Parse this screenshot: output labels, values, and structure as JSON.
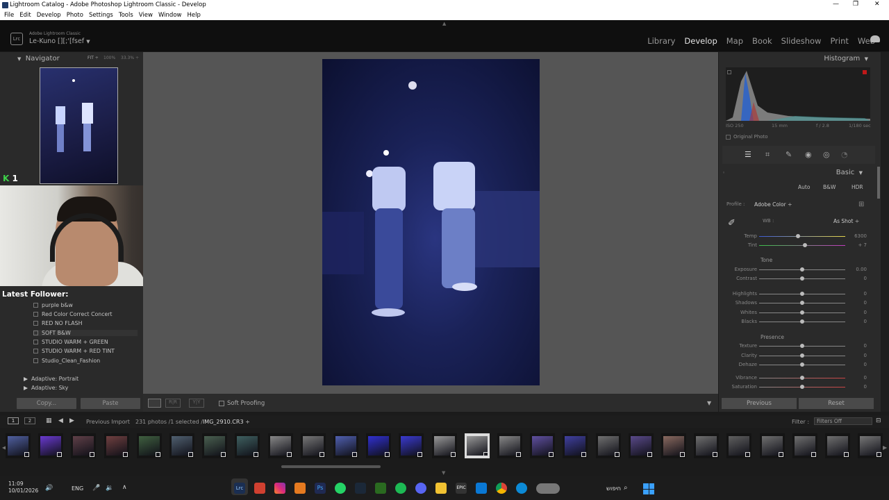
{
  "window": {
    "title": "Lightroom Catalog - Adobe Photoshop Lightroom Classic - Develop"
  },
  "menu": [
    "File",
    "Edit",
    "Develop",
    "Photo",
    "Settings",
    "Tools",
    "View",
    "Window",
    "Help"
  ],
  "identity": {
    "app_small": "Adobe Lightroom Classic",
    "catalog": "Le-Kuno [][;'[fsef",
    "logo": "Lrc"
  },
  "modules": [
    "Library",
    "Develop",
    "Map",
    "Book",
    "Slideshow",
    "Print",
    "Web"
  ],
  "active_module": "Develop",
  "navigator": {
    "title": "Navigator",
    "fit": "FIT ÷",
    "p100": "100%",
    "p33": "33.3% ÷"
  },
  "overlay": {
    "k_icon": "K",
    "k_count": "1",
    "latest_follower": "Latest Follower:"
  },
  "presets": [
    "purple b&w",
    "Red Color Correct Concert",
    "RED NO FLASH",
    "SOFT B&W",
    "STUDIO WARM + GREEN",
    "STUDIO WARM + RED TINT",
    "Studio_Clean_Fashion"
  ],
  "preset_groups": [
    "Adaptive: Portrait",
    "Adaptive: Sky"
  ],
  "left_buttons": {
    "copy": "Copy...",
    "paste": "Paste"
  },
  "toolbar": {
    "soft_proofing": "Soft Proofing"
  },
  "histogram": {
    "title": "Histogram",
    "iso": "ISO 250",
    "focal": "15 mm",
    "aperture": "f / 2.8",
    "shutter": "1/180 sec",
    "original_photo": "Original Photo"
  },
  "basic": {
    "title": "Basic",
    "modes": [
      "Auto",
      "B&W",
      "HDR"
    ],
    "profile_label": "Profile :",
    "profile_value": "Adobe Color ÷",
    "wb_label": "WB :",
    "wb_value": "As Shot ÷",
    "tone_label": "Tone",
    "presence_label": "Presence",
    "sliders": [
      {
        "label": "Temp",
        "value": "6300",
        "pos": 0.45
      },
      {
        "label": "Tint",
        "value": "+ 7",
        "pos": 0.53
      },
      {
        "label": "Exposure",
        "value": "0.00",
        "pos": 0.5
      },
      {
        "label": "Contrast",
        "value": "0",
        "pos": 0.5
      },
      {
        "label": "Highlights",
        "value": "0",
        "pos": 0.5
      },
      {
        "label": "Shadows",
        "value": "0",
        "pos": 0.5
      },
      {
        "label": "Whites",
        "value": "0",
        "pos": 0.5
      },
      {
        "label": "Blacks",
        "value": "0",
        "pos": 0.5
      },
      {
        "label": "Texture",
        "value": "0",
        "pos": 0.5
      },
      {
        "label": "Clarity",
        "value": "0",
        "pos": 0.5
      },
      {
        "label": "Dehaze",
        "value": "0",
        "pos": 0.5
      },
      {
        "label": "Vibrance",
        "value": "0",
        "pos": 0.5
      },
      {
        "label": "Saturation",
        "value": "0",
        "pos": 0.5
      }
    ]
  },
  "right_buttons": {
    "previous": "Previous",
    "reset": "Reset"
  },
  "filmstrip": {
    "page1": "1",
    "page2": "2",
    "source": "Previous Import",
    "info": "231 photos /1 selected /",
    "filename": "IMG_2910.CR3 ÷",
    "filter_label": "Filter :",
    "filter_value": "Filters Off"
  },
  "taskbar": {
    "time": "11:09",
    "date": "10/01/2026",
    "lang": "ENG",
    "search": "חיפוש"
  }
}
